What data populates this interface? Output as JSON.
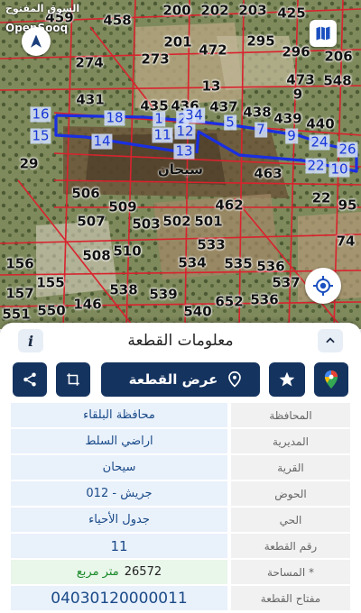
{
  "brand": {
    "arabic": "السوق المفتوح",
    "name": "OpenSooq"
  },
  "map": {
    "village_label": "سيحان",
    "parcel_numbers": [
      "458",
      "200",
      "202",
      "203",
      "425",
      "459",
      "201",
      "472",
      "295",
      "296",
      "206",
      "274",
      "273",
      "13",
      "473",
      "548",
      "431",
      "435",
      "436",
      "437",
      "438",
      "439",
      "440",
      "9",
      "11",
      "29",
      "463",
      "506",
      "509",
      "503",
      "502",
      "501",
      "462",
      "22",
      "95",
      "507",
      "510",
      "533",
      "74",
      "508",
      "534",
      "535",
      "536",
      "156",
      "155",
      "538",
      "539",
      "537",
      "157",
      "551",
      "550",
      "146",
      "540",
      "652",
      "536"
    ],
    "boundary_points": [
      "16",
      "18",
      "1",
      "2",
      "3",
      "4",
      "5",
      "7",
      "9",
      "24",
      "26",
      "15",
      "14",
      "11",
      "12",
      "13",
      "22",
      "10"
    ]
  },
  "panel": {
    "title": "معلومات القطعة",
    "show_parcel_label": "عرض القطعة",
    "rows": [
      {
        "label": "المحافظة",
        "value": "محافظة البلقاء"
      },
      {
        "label": "المديرية",
        "value": "اراضي السلط"
      },
      {
        "label": "القرية",
        "value": "سيحان"
      },
      {
        "label": "الحوض",
        "value": "جريش - 012"
      },
      {
        "label": "الحي",
        "value": "جدول الأحياء"
      },
      {
        "label": "رقم القطعة",
        "value": "11"
      },
      {
        "label": "المساحة *",
        "value": "26572",
        "unit": "متر مربع"
      },
      {
        "label": "مفتاح القطعة",
        "value": "04030120000011"
      }
    ]
  },
  "icons": [
    "compass-icon",
    "map-book-icon",
    "locate-icon",
    "info-icon",
    "chevron-up-icon",
    "share-icon",
    "crop-shape-icon",
    "location-pin-icon",
    "star-icon",
    "google-maps-icon"
  ]
}
